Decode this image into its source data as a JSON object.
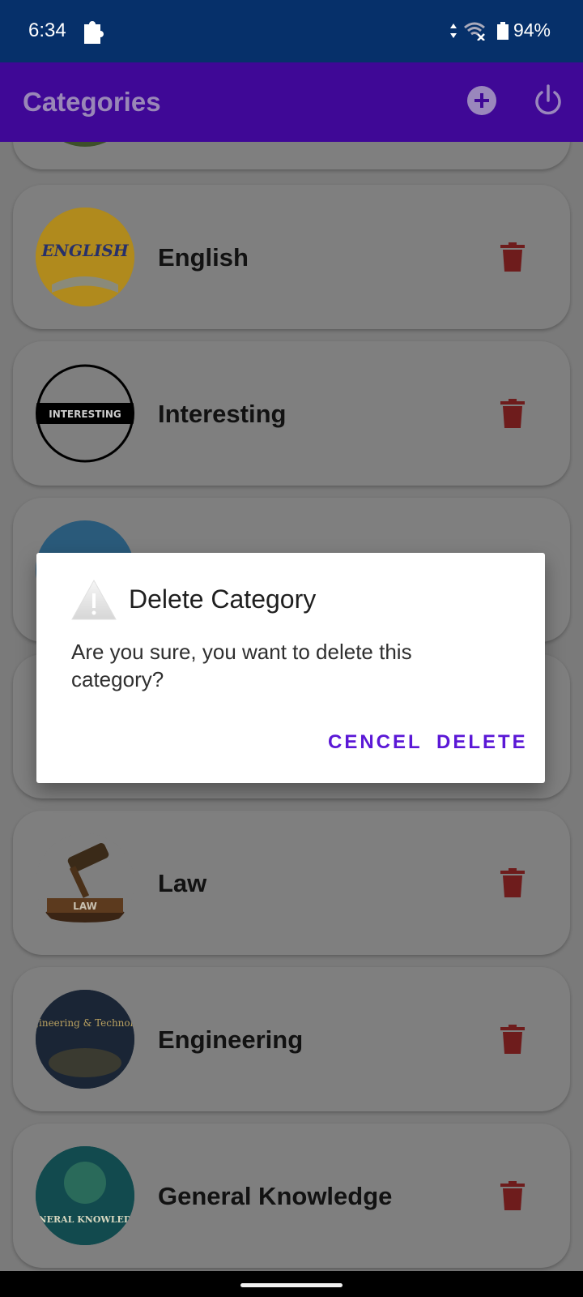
{
  "status_bar": {
    "time": "6:34",
    "battery": "94%",
    "icons": [
      "puzzle-icon",
      "signal-icon",
      "wifi-off-icon",
      "battery-icon"
    ]
  },
  "app_bar": {
    "title": "Categories",
    "icons": [
      "add-circle-icon",
      "power-icon"
    ],
    "color": "#3f0896"
  },
  "categories": [
    {
      "name": "English",
      "icon": "english-thumbnail"
    },
    {
      "name": "Interesting",
      "icon": "interesting-thumbnail",
      "thumb_text": "INTERESTING"
    },
    {
      "name": "Law",
      "icon": "law-thumbnail",
      "thumb_text": "LAW"
    },
    {
      "name": "Engineering",
      "icon": "engineering-thumbnail",
      "thumb_text": "Engineering & Technology"
    },
    {
      "name": "General Knowledge",
      "icon": "general-knowledge-thumbnail",
      "thumb_text": "GENERAL KNOWLEDGE"
    }
  ],
  "dialog": {
    "title": "Delete Category",
    "message": "Are you sure, you want to delete this category?",
    "cancel_label": "CENCEL",
    "delete_label": "DELETE",
    "accent": "#5b18d6"
  },
  "colors": {
    "status_bar": "#06306a",
    "trash": "#8e1f1f"
  }
}
